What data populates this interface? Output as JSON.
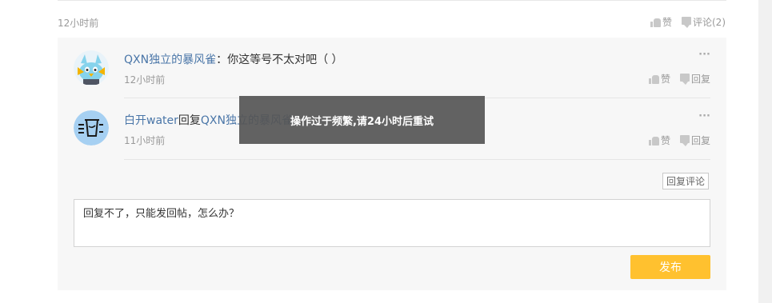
{
  "post": {
    "time": "12小时前",
    "like_label": "赞",
    "comment_label": "评论(2)"
  },
  "replies": [
    {
      "user": "QXN独立的暴风雀",
      "sep": "：",
      "content": "你这等号不太对吧（ ）",
      "time": "12小时前",
      "like_label": "赞",
      "reply_label": "回复",
      "more": "···"
    },
    {
      "user": "白开water",
      "reply_word": "回复",
      "reply_to": "QXN独立的暴风雀",
      "time": "11小时前",
      "like_label": "赞",
      "reply_label": "回复",
      "more": "···"
    }
  ],
  "reply_comment_label": "回复评论",
  "reply_box": {
    "value": "回复不了，只能发回帖，怎么办？"
  },
  "publish_label": "发布",
  "toast": "操作过于频繁,请24小时后重试",
  "colors": {
    "username": "#4a76a8",
    "publish": "#ffc12f",
    "panel": "#f7f7f7"
  }
}
